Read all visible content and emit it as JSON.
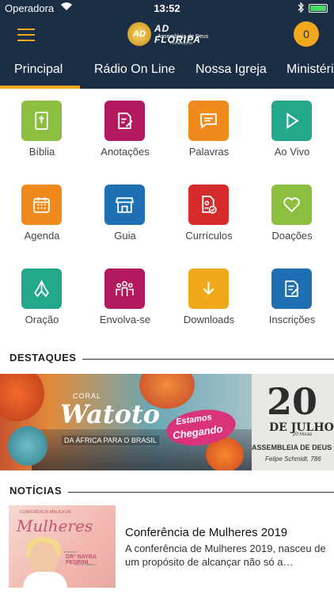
{
  "status_bar": {
    "carrier": "Operadora",
    "time": "13:52"
  },
  "header": {
    "logo_mark": "AD",
    "logo_title": "AD FLORIPA",
    "logo_subtitle": "Assembleia de Deus",
    "logo_city": "Florianópolis",
    "cart_count": "0",
    "accent_color": "#f0a81d",
    "bar_color": "#1c2e45"
  },
  "tabs": [
    {
      "label": "Principal",
      "active": true
    },
    {
      "label": "Rádio On Line",
      "active": false
    },
    {
      "label": "Nossa Igreja",
      "active": false
    },
    {
      "label": "Ministérios",
      "active": false
    }
  ],
  "grid": [
    {
      "label": "Bíblia",
      "icon": "bible-icon",
      "color": "#8cbf3f"
    },
    {
      "label": "Anotações",
      "icon": "notes-icon",
      "color": "#b3195e"
    },
    {
      "label": "Palavras",
      "icon": "chat-bubble-icon",
      "color": "#f08a1c"
    },
    {
      "label": "Ao Vivo",
      "icon": "play-icon",
      "color": "#24a88c"
    },
    {
      "label": "Agenda",
      "icon": "calendar-icon",
      "color": "#f08a1c"
    },
    {
      "label": "Guia",
      "icon": "storefront-icon",
      "color": "#1f6fb3"
    },
    {
      "label": "Currículos",
      "icon": "document-check-icon",
      "color": "#d62b2b"
    },
    {
      "label": "Doações",
      "icon": "heart-icon",
      "color": "#8cbf3f"
    },
    {
      "label": "Oração",
      "icon": "praying-hands-icon",
      "color": "#24a88c"
    },
    {
      "label": "Envolva-se",
      "icon": "people-icon",
      "color": "#b3195e"
    },
    {
      "label": "Downloads",
      "icon": "download-icon",
      "color": "#f0a81d"
    },
    {
      "label": "Inscrições",
      "icon": "form-edit-icon",
      "color": "#1f6fb3"
    }
  ],
  "highlights": {
    "title": "DESTAQUES",
    "banner": {
      "coral": "CORAL",
      "name": "Watoto",
      "subtitle": "DA ÁFRICA PARA O BRASIL",
      "tag_line1": "Estamos",
      "tag_line2": "Chegando",
      "day": "20",
      "month": "DE JULHO",
      "hours": "20 Horas",
      "church": "ASSEMBLEIA DE DEUS",
      "address": "Felipe Schmidt, 786"
    }
  },
  "news": {
    "title": "NOTÍCIAS",
    "items": [
      {
        "thumb_kicker": "CONFERÊNCIA BÍBLICA DE",
        "thumb_title": "Mulheres",
        "thumb_preacher_label": "preletora",
        "thumb_preacher": "DRª NAYRA PEDRINI",
        "thumb_city": "Rio de Janeiro",
        "headline": "Conferência de Mulheres 2019",
        "excerpt": "A conferência de Mulheres 2019, nasceu de um propósito de alcançar não só a…"
      }
    ]
  }
}
